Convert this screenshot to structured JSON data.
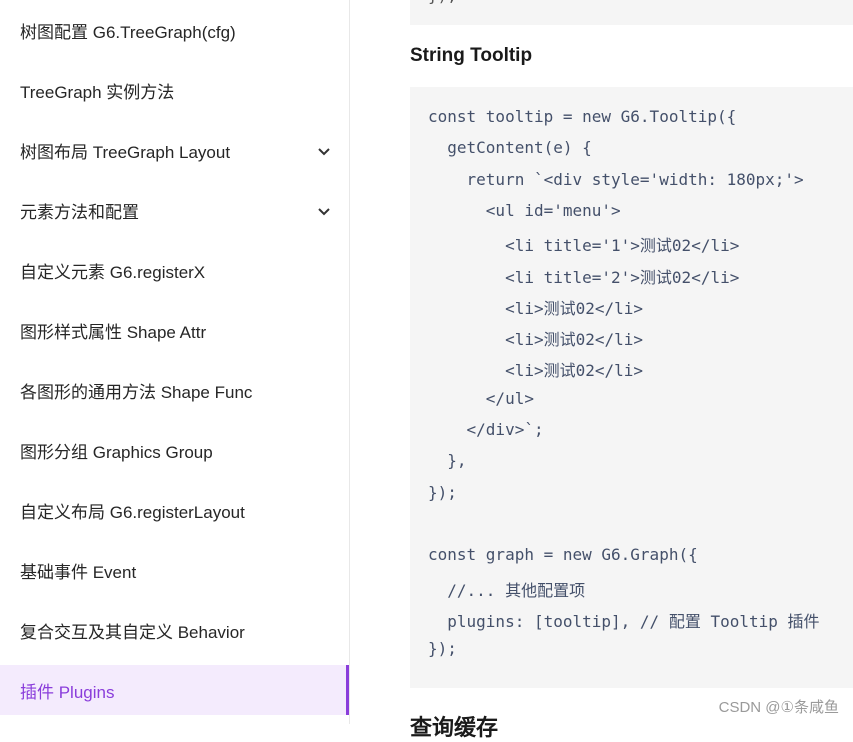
{
  "sidebar": {
    "items": [
      {
        "label": "树图配置 G6.TreeGraph(cfg)",
        "has_chevron": false
      },
      {
        "label": "TreeGraph 实例方法",
        "has_chevron": false
      },
      {
        "label": "树图布局 TreeGraph Layout",
        "has_chevron": true
      },
      {
        "label": "元素方法和配置",
        "has_chevron": true
      },
      {
        "label": "自定义元素 G6.registerX",
        "has_chevron": false
      },
      {
        "label": "图形样式属性 Shape Attr",
        "has_chevron": false
      },
      {
        "label": "各图形的通用方法 Shape Func",
        "has_chevron": false
      },
      {
        "label": "图形分组 Graphics Group",
        "has_chevron": false
      },
      {
        "label": "自定义布局 G6.registerLayout",
        "has_chevron": false
      },
      {
        "label": "基础事件 Event",
        "has_chevron": false
      },
      {
        "label": "复合交互及其自定义 Behavior",
        "has_chevron": false
      },
      {
        "label": "插件 Plugins",
        "has_chevron": false,
        "active": true
      }
    ],
    "active_color": "#8a3ddb"
  },
  "main": {
    "prev_code_tail": "});",
    "section_title": "String Tooltip",
    "code_lines": [
      "const tooltip = new G6.Tooltip({",
      "  getContent(e) {",
      "    return `<div style='width: 180px;'>",
      "      <ul id='menu'>",
      "        <li title='1'>测试02</li>",
      "        <li title='2'>测试02</li>",
      "        <li>测试02</li>",
      "        <li>测试02</li>",
      "        <li>测试02</li>",
      "      </ul>",
      "    </div>`;",
      "  },",
      "});",
      "",
      "const graph = new G6.Graph({",
      "  //... 其他配置项",
      "  plugins: [tooltip], // 配置 Tooltip 插件",
      "});"
    ],
    "next_heading": "查询缓存"
  },
  "watermark": "CSDN @①条咸鱼"
}
